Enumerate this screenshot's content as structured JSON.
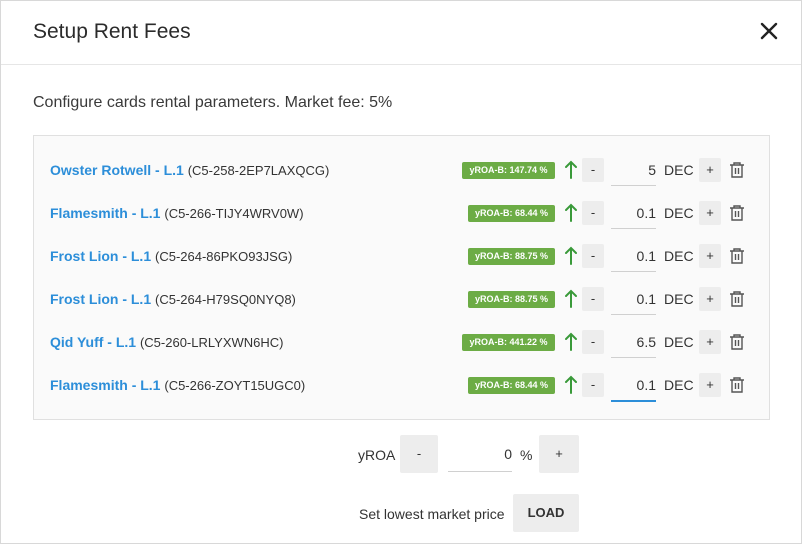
{
  "dialog": {
    "title": "Setup Rent Fees",
    "description": "Configure cards rental parameters. Market fee: 5%"
  },
  "cards": [
    {
      "name": "Owster Rotwell - L.1",
      "id": "(C5-258-2EP7LAXQCG)",
      "yroa": "yROA-B: 147.74 %",
      "price": "5",
      "unit": "DEC"
    },
    {
      "name": "Flamesmith - L.1",
      "id": "(C5-266-TIJY4WRV0W)",
      "yroa": "yROA-B: 68.44 %",
      "price": "0.1",
      "unit": "DEC"
    },
    {
      "name": "Frost Lion - L.1",
      "id": "(C5-264-86PKO93JSG)",
      "yroa": "yROA-B: 88.75 %",
      "price": "0.1",
      "unit": "DEC"
    },
    {
      "name": "Frost Lion - L.1",
      "id": "(C5-264-H79SQ0NYQ8)",
      "yroa": "yROA-B: 88.75 %",
      "price": "0.1",
      "unit": "DEC"
    },
    {
      "name": "Qid Yuff - L.1",
      "id": "(C5-260-LRLYXWN6HC)",
      "yroa": "yROA-B: 441.22 %",
      "price": "6.5",
      "unit": "DEC"
    },
    {
      "name": "Flamesmith - L.1",
      "id": "(C5-266-ZOYT15UGC0)",
      "yroa": "yROA-B: 68.44 %",
      "price": "0.1",
      "unit": "DEC"
    }
  ],
  "buttons": {
    "minus": "-",
    "plus": "+"
  },
  "yroa_control": {
    "label": "yROA",
    "value": "0",
    "unit": "%"
  },
  "lowest_price": {
    "label": "Set lowest market price",
    "button": "LOAD"
  },
  "colors": {
    "link": "#2c8ed9",
    "badge": "#6cac45",
    "arrow": "#3a9a3a"
  }
}
